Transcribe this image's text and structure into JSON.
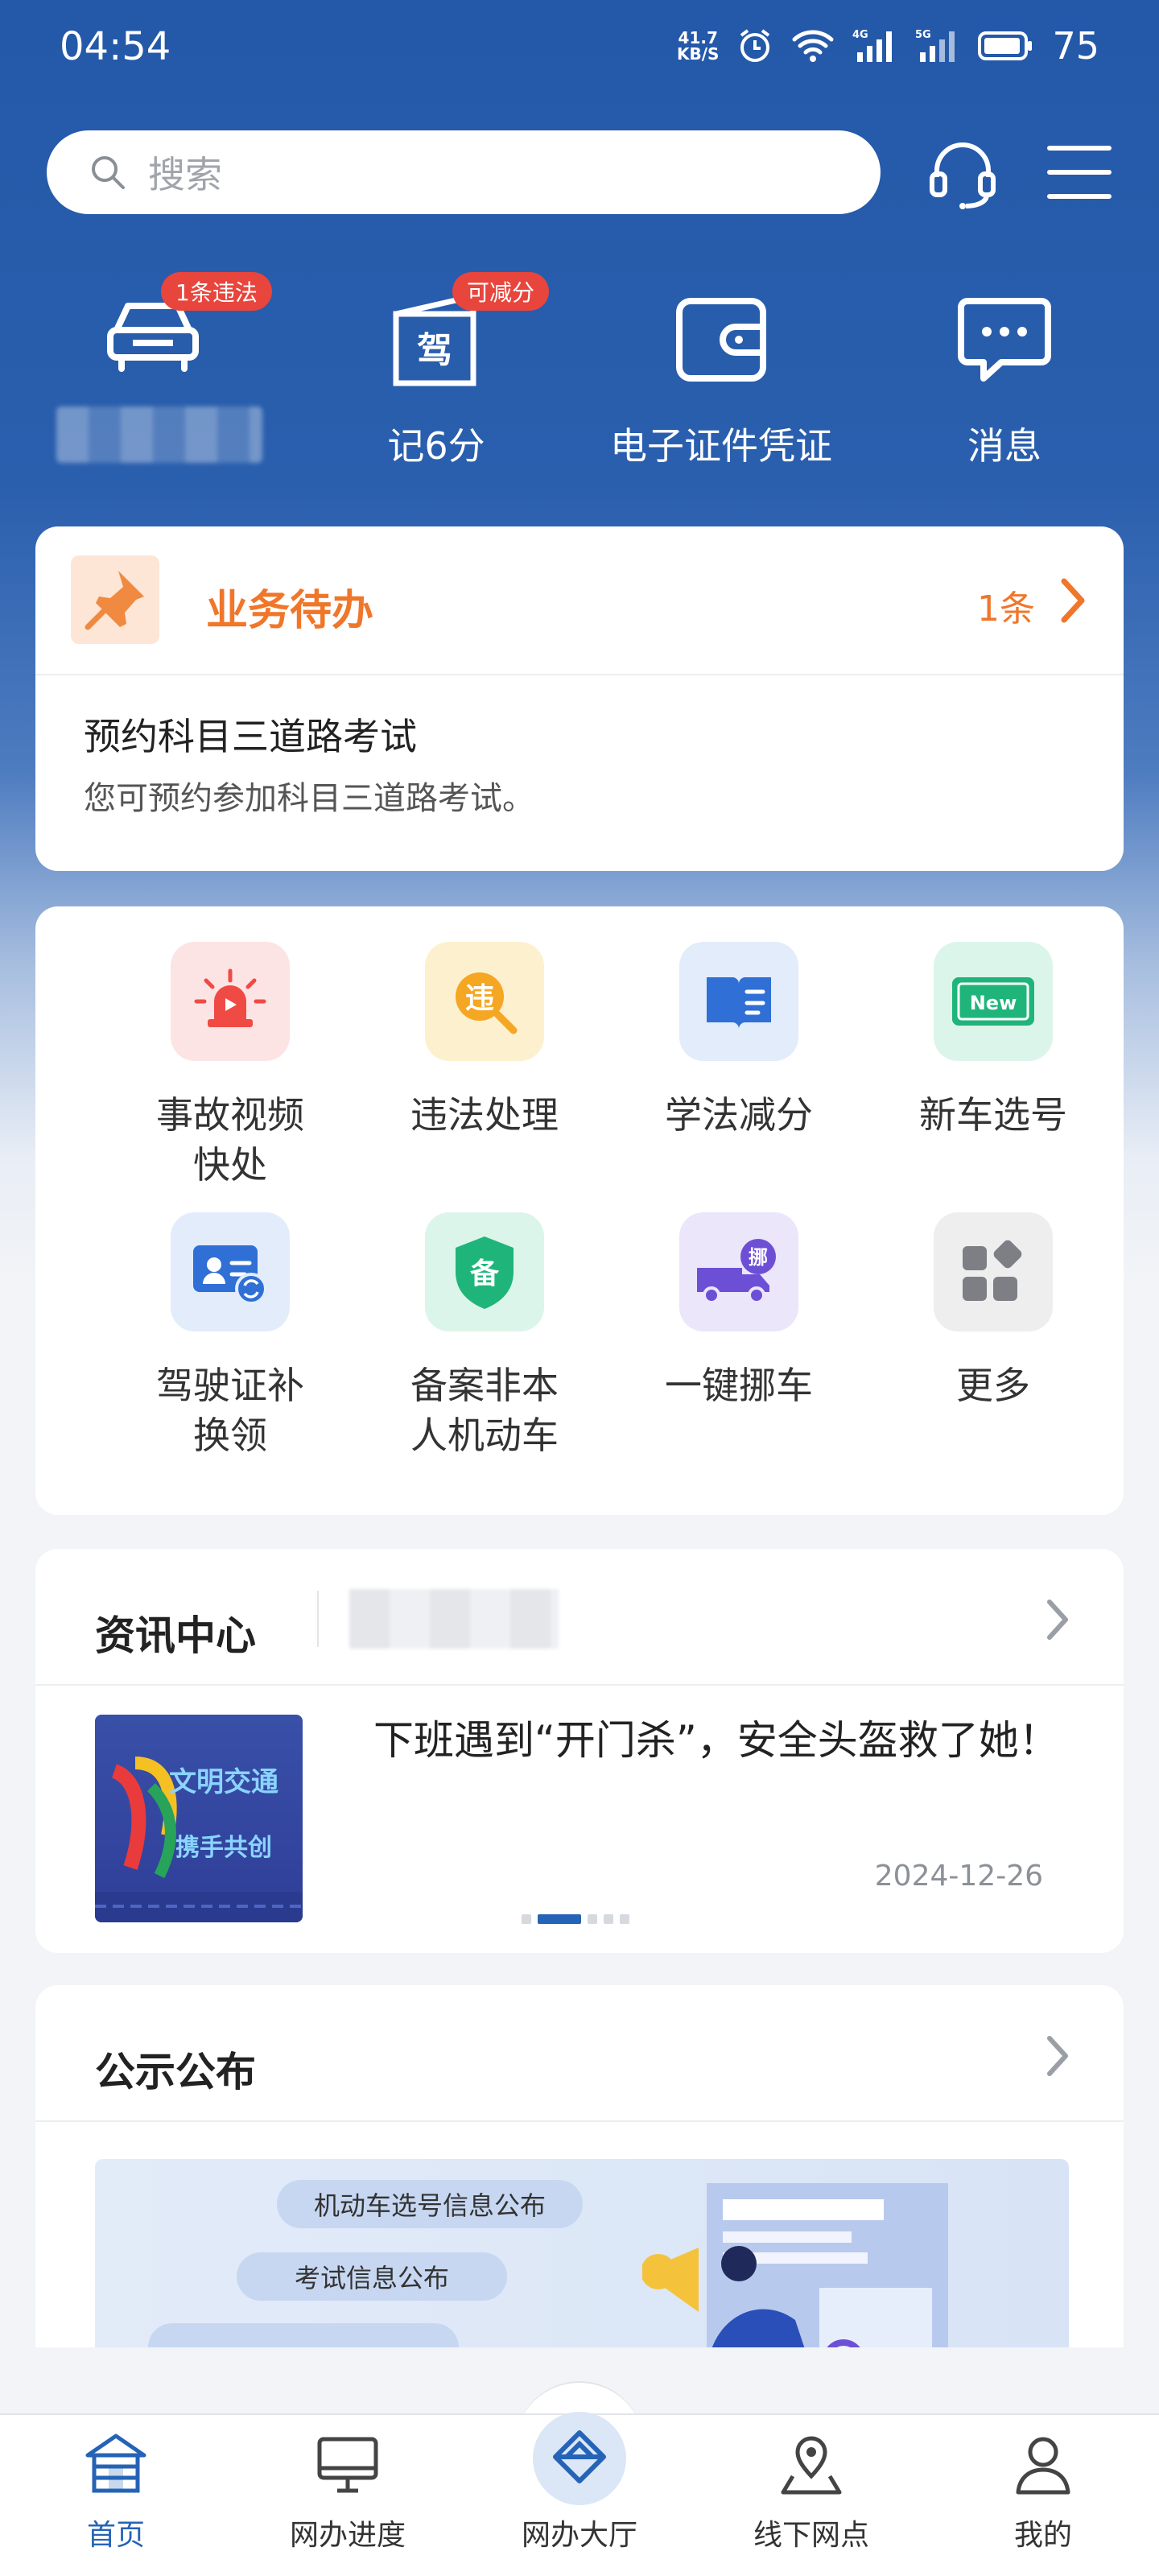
{
  "status_bar": {
    "time": "04:54",
    "net_speed_value": "41.7",
    "net_speed_unit": "KB/S",
    "battery": "75",
    "signal_labels": [
      "4G",
      "5G"
    ]
  },
  "header": {
    "search_placeholder": "搜索",
    "icons": [
      "headset-icon",
      "menu-icon"
    ]
  },
  "quick_actions": [
    {
      "label": "",
      "badge": "1条违法",
      "icon": "car-icon"
    },
    {
      "label": "记6分",
      "badge": "可减分",
      "icon": "license-icon",
      "icon_text": "驾"
    },
    {
      "label": "电子证件凭证",
      "badge": "",
      "icon": "wallet-icon"
    },
    {
      "label": "消息",
      "badge": "",
      "icon": "message-icon"
    }
  ],
  "todo": {
    "title": "业务待办",
    "count": "1条",
    "item_title": "预约科目三道路考试",
    "item_desc": "您可预约参加科目三道路考试。"
  },
  "services": [
    {
      "label1": "事故视频",
      "label2": "快处",
      "icon": "alarm-icon",
      "bg": "#fde4e4"
    },
    {
      "label1": "违法处理",
      "label2": "",
      "icon": "violation-icon",
      "bg": "#fdf0cf",
      "icon_text": "违"
    },
    {
      "label1": "学法减分",
      "label2": "",
      "icon": "book-icon",
      "bg": "#e2ecfb"
    },
    {
      "label1": "新车选号",
      "label2": "",
      "icon": "new-plate-icon",
      "bg": "#dcf5ea",
      "icon_text": "New"
    },
    {
      "label1": "驾驶证补",
      "label2": "换领",
      "icon": "license-renew-icon",
      "bg": "#e2ecfb"
    },
    {
      "label1": "备案非本",
      "label2": "人机动车",
      "icon": "shield-icon",
      "bg": "#dcf5ea",
      "icon_text": "备"
    },
    {
      "label1": "一键挪车",
      "label2": "",
      "icon": "truck-icon",
      "bg": "#ece6fa",
      "icon_text": "挪"
    },
    {
      "label1": "更多",
      "label2": "",
      "icon": "more-grid-icon",
      "bg": "#eeeeee"
    }
  ],
  "news": {
    "section_title": "资讯中心",
    "headline": "下班遇到“开门杀”，安全头盔救了她！",
    "date": "2024-12-26",
    "thumb_text": "文明交通 携手共创"
  },
  "notices": {
    "section_title": "公示公布",
    "pills": [
      "机动车选号信息公布",
      "考试信息公布"
    ]
  },
  "bottom_nav": [
    {
      "label": "首页",
      "icon": "home-icon",
      "active": true
    },
    {
      "label": "网办进度",
      "icon": "monitor-icon",
      "active": false
    },
    {
      "label": "网办大厅",
      "icon": "hall-icon",
      "active": false
    },
    {
      "label": "线下网点",
      "icon": "location-icon",
      "active": false
    },
    {
      "label": "我的",
      "icon": "user-icon",
      "active": false
    }
  ],
  "colors": {
    "brand_blue": "#2458a8",
    "accent_orange": "#f0762a",
    "badge_red": "#e8453c",
    "active_nav": "#2563b6"
  }
}
